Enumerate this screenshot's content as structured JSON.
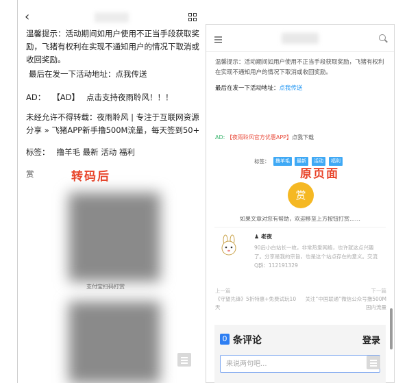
{
  "left": {
    "back_icon": "chevron-left",
    "qr_icon": "grid-icon",
    "notice": "温馨提示：活动期间如用户使用不正当手段获取奖励，飞猪有权利在实现不通知用户的情况下取消或收回奖励。",
    "last_activity_prefix": "最后在发一下活动地址：",
    "last_activity_link": "点我传送",
    "ad_prefix": "AD：",
    "ad_tag": "【AD】",
    "ad_text": "点击支持夜雨聆风！！！",
    "repost": "未经允许不得转载：夜雨聆风 | 专注于互联网资源分享 » 飞猪APP新手撸500M流量，每天签到50+",
    "tags_label": "标签：",
    "tags": [
      "撸羊毛",
      "最新",
      "活动",
      "福利"
    ],
    "reward_char": "赏",
    "annotation": "转码后",
    "qr_caption": "支付宝扫码打赏"
  },
  "right": {
    "menu_icon": "hamburger-icon",
    "search_icon": "search-icon",
    "notice": "温馨提示：活动期间如用户使用不正当手段获取奖励，飞猪有权利在实现不通知用户的情况下取消或收回奖励。",
    "last_activity_prefix": "最后在发一下活动地址：",
    "last_activity_link": "点我传送",
    "ad_prefix": "AD:",
    "ad_link": "【夜雨聆风官方优惠APP】",
    "ad_suffix": "点我下载",
    "tags_label": "标签：",
    "tags": [
      "撸羊毛",
      "最新",
      "活动",
      "福利"
    ],
    "annotation": "原页面",
    "reward_button": "赏",
    "reward_hint": "如果文章对您有帮助，欢迎移至上方按钮打赏……",
    "author_name": "老夜",
    "author_bio": "90后小白站长一枚，非常热爱网络，也许就这点兴趣了。分享是我的宗旨，也是这个站点存在的意义。交流Q群：112191329",
    "prev_label": "上一篇",
    "prev_title": "《守望先锋》5折特惠+免费试玩10天",
    "next_label": "下一篇",
    "next_title": "关注“中国联通”微信公众号撸500M国内流量",
    "comment_count": "0",
    "comment_title": "条评论",
    "login": "登录",
    "comment_placeholder": "来说两句吧..."
  },
  "colors": {
    "annotation_red": "#e8442a",
    "link_blue": "#2196f3",
    "tag_blue": "#3fa9f5",
    "reward_gold": "#f5b823",
    "comment_badge": "#2d7ef2"
  }
}
